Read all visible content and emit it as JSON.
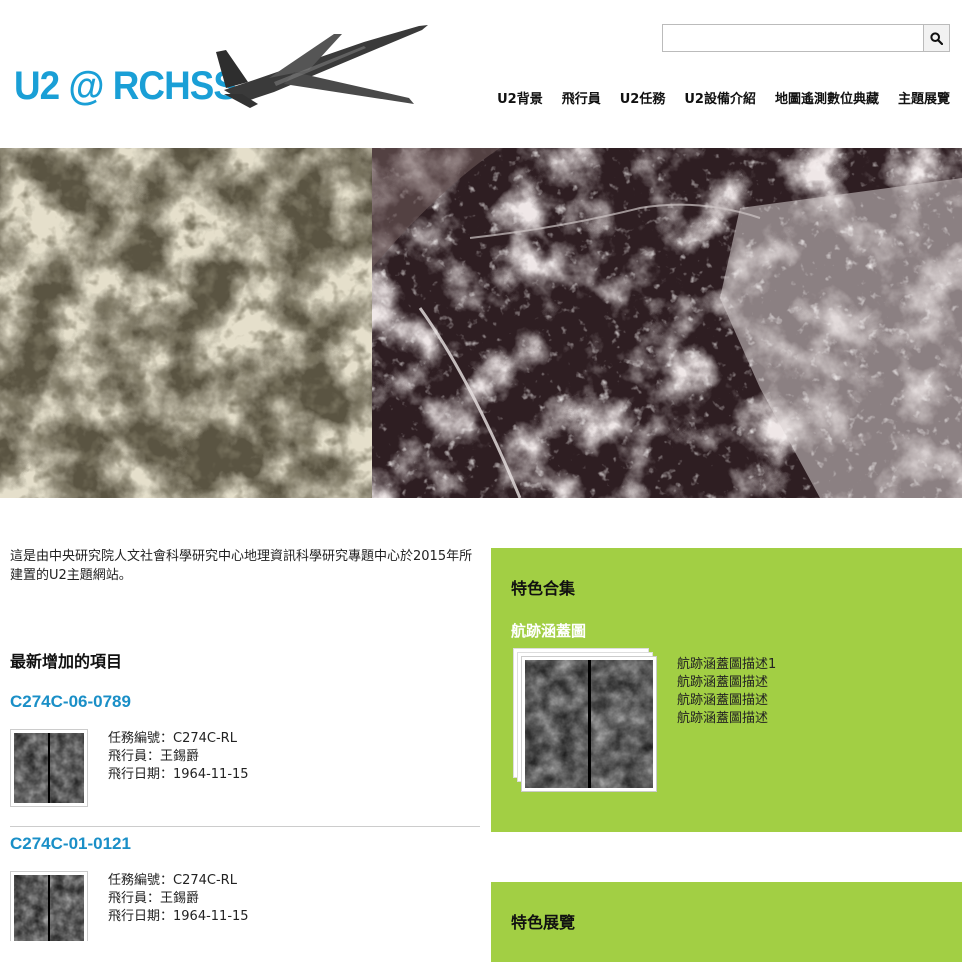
{
  "site": {
    "logo": "U2 @ RCHSS"
  },
  "search": {
    "placeholder": "",
    "value": "",
    "icon": "search-icon"
  },
  "nav": {
    "items": [
      {
        "label": "U2背景"
      },
      {
        "label": "飛行員"
      },
      {
        "label": "U2任務"
      },
      {
        "label": "U2設備介紹"
      },
      {
        "label": "地圖遙測數位典藏"
      },
      {
        "label": "主題展覽"
      }
    ]
  },
  "intro": {
    "text": "這是由中央研究院人文社會科學研究中心地理資訊科學研究專題中心於2015年所建置的U2主題網站。"
  },
  "recent": {
    "title": "最新增加的項目",
    "items": [
      {
        "title": "C274C-06-0789",
        "mission": "任務編號：C274C-RL",
        "pilot": "飛行員：王錫爵",
        "date": "飛行日期：1964-11-15"
      },
      {
        "title": "C274C-01-0121",
        "mission": "任務編號：C274C-RL",
        "pilot": "飛行員：王錫爵",
        "date": "飛行日期：1964-11-15"
      }
    ]
  },
  "featured_collection": {
    "title": "特色合集",
    "collection_title": "航跡涵蓋圖",
    "descriptions": [
      "航跡涵蓋圖描述1",
      "航跡涵蓋圖描述",
      "航跡涵蓋圖描述",
      "航跡涵蓋圖描述"
    ]
  },
  "featured_exhibit": {
    "title": "特色展覽"
  },
  "colors": {
    "accent": "#1a9fd6",
    "panel": "#a2cf44",
    "link": "#1a8fc7"
  }
}
